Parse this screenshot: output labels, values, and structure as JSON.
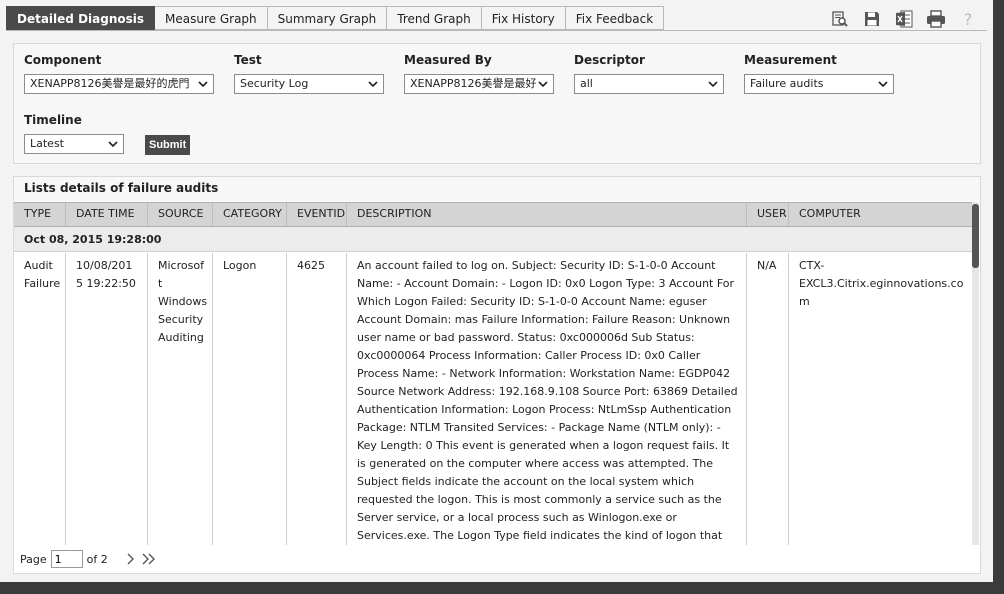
{
  "tabs": [
    "Detailed Diagnosis",
    "Measure Graph",
    "Summary Graph",
    "Trend Graph",
    "Fix History",
    "Fix Feedback"
  ],
  "toolbar": {
    "icons": [
      "zoom-icon",
      "save-icon",
      "excel-icon",
      "print-icon",
      "help-icon"
    ]
  },
  "form": {
    "component": {
      "label": "Component",
      "value": "XENAPP8126美譽是最好的虎門"
    },
    "test": {
      "label": "Test",
      "value": "Security Log"
    },
    "measured_by": {
      "label": "Measured By",
      "value": "XENAPP8126美譽是最好"
    },
    "descriptor": {
      "label": "Descriptor",
      "value": "all"
    },
    "measurement": {
      "label": "Measurement",
      "value": "Failure audits"
    },
    "timeline": {
      "label": "Timeline",
      "value": "Latest"
    },
    "submit_label": "Submit"
  },
  "panel": {
    "title": "Lists details of failure audits",
    "columns": [
      "TYPE",
      "DATE TIME",
      "SOURCE",
      "CATEGORY",
      "EVENTID",
      "DESCRIPTION",
      "USER",
      "COMPUTER"
    ],
    "group": "Oct 08, 2015 19:28:00",
    "row": {
      "type": "Audit Failure",
      "datetime": "10/08/2015 19:22:50",
      "source": "Microsoft Windows Security Auditing",
      "category": "Logon",
      "eventid": "4625",
      "description": "An account failed to log on. Subject: Security ID: S-1-0-0 Account Name: - Account Domain: - Logon ID: 0x0 Logon Type: 3 Account For Which Logon Failed: Security ID: S-1-0-0 Account Name: eguser Account Domain: mas Failure Information: Failure Reason: Unknown user name or bad password. Status: 0xc000006d Sub Status: 0xc0000064 Process Information: Caller Process ID: 0x0 Caller Process Name: - Network Information: Workstation Name: EGDP042 Source Network Address: 192.168.9.108 Source Port: 63869 Detailed Authentication Information: Logon Process: NtLmSsp Authentication Package: NTLM Transited Services: - Package Name (NTLM only): - Key Length: 0 This event is generated when a logon request fails. It is generated on the computer where access was attempted. The Subject fields indicate the account on the local system which requested the logon. This is most commonly a service such as the Server service, or a local process such as Winlogon.exe or Services.exe. The Logon Type field indicates the kind of logon that was requested. The most common",
      "user": "N/A",
      "computer": "CTX-EXCL3.Citrix.eginnovations.com"
    }
  },
  "pager": {
    "page_label": "Page",
    "page_value": "1",
    "of_label": "of 2"
  }
}
